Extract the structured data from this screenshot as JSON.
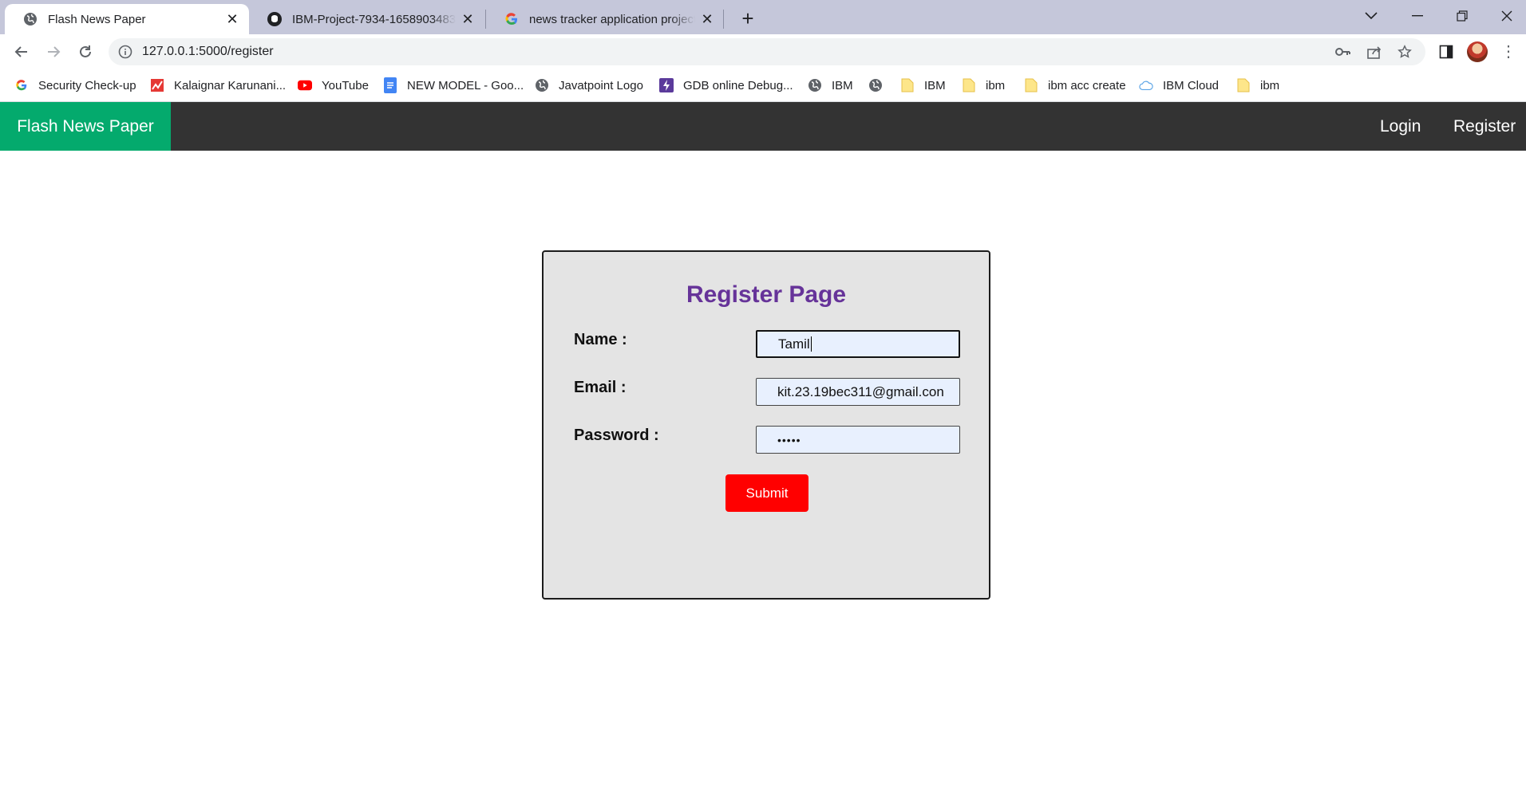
{
  "browser": {
    "tabs": [
      {
        "title": "Flash News Paper",
        "icon": "globe-icon",
        "active": true
      },
      {
        "title": "IBM-Project-7934-1658903483/index",
        "icon": "github-icon",
        "active": false
      },
      {
        "title": "news tracker application project",
        "icon": "google-icon",
        "active": false
      }
    ],
    "address": "127.0.0.1:5000/register",
    "bookmarks": [
      {
        "label": "Security Check-up",
        "icon": "google-icon"
      },
      {
        "label": "Kalaignar Karunani...",
        "icon": "kalaignar-icon"
      },
      {
        "label": "YouTube",
        "icon": "youtube-icon"
      },
      {
        "label": "NEW MODEL - Goo...",
        "icon": "docs-icon"
      },
      {
        "label": "Javatpoint Logo",
        "icon": "globe-icon"
      },
      {
        "label": "GDB online Debug...",
        "icon": "gdb-icon"
      },
      {
        "label": "IBM",
        "icon": "globe-icon"
      },
      {
        "label": "",
        "icon": "globe-icon"
      },
      {
        "label": "IBM",
        "icon": "folder-icon"
      },
      {
        "label": "ibm",
        "icon": "folder-icon"
      },
      {
        "label": "ibm acc create",
        "icon": "folder-icon"
      },
      {
        "label": "IBM Cloud",
        "icon": "cloud-icon"
      },
      {
        "label": "ibm",
        "icon": "folder-icon"
      }
    ]
  },
  "page": {
    "brand": "Flash News Paper",
    "nav": {
      "login": "Login",
      "register": "Register"
    },
    "form": {
      "title": "Register Page",
      "name_label": "Name :",
      "name_value": "Tamil",
      "email_label": "Email :",
      "email_value": "kit.23.19bec311@gmail.con",
      "password_label": "Password :",
      "password_value": "•••••",
      "submit_label": "Submit"
    }
  },
  "colors": {
    "brand_green": "#04aa6d",
    "navbar": "#333333",
    "title_purple": "#663399",
    "submit_red": "#ff0000",
    "card_bg": "#e4e4e4"
  }
}
